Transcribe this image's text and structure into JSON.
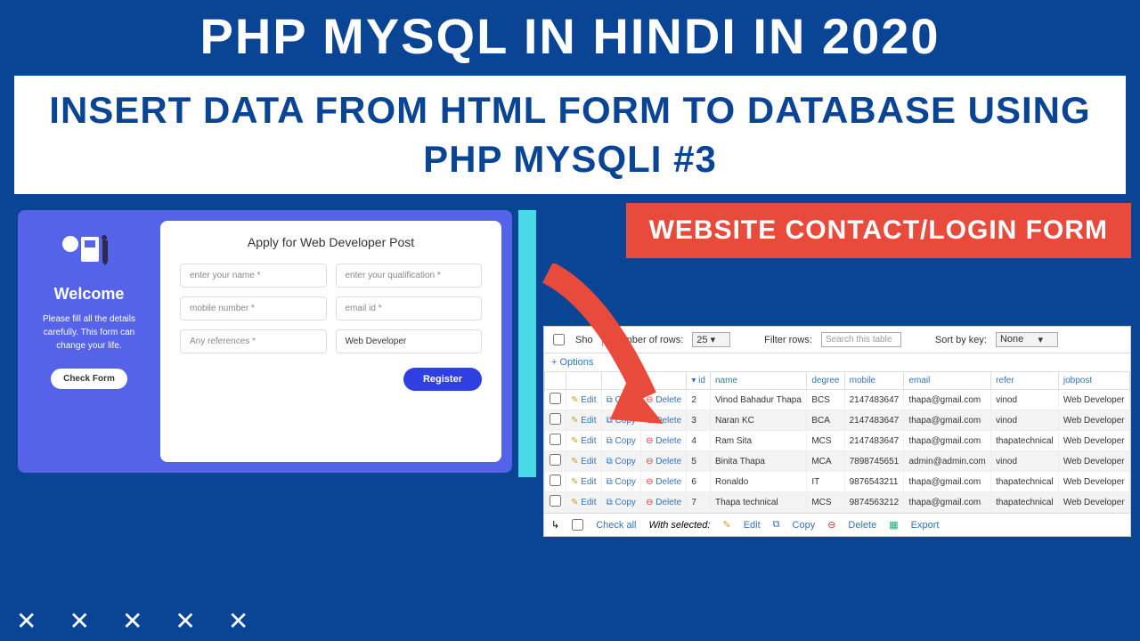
{
  "header": {
    "title": "PHP MYSQL IN HINDI IN 2020",
    "subtitle": "INSERT DATA FROM HTML FORM TO DATABASE USING PHP MYSQLI   #3"
  },
  "callout": "WEBSITE CONTACT/LOGIN FORM",
  "form": {
    "welcome": "Welcome",
    "intro": "Please fill all the details carefully. This form can change your life.",
    "check_btn": "Check Form",
    "title": "Apply for Web Developer Post",
    "fields": {
      "name": "enter your name *",
      "qualification": "enter your qualification *",
      "mobile": "mobile number *",
      "email": "email id *",
      "refs": "Any references *",
      "role": "Web Developer"
    },
    "register_btn": "Register"
  },
  "db": {
    "show_label": "Sho",
    "rows_label": "Number of rows:",
    "rows_value": "25",
    "filter_label": "Filter rows:",
    "filter_placeholder": "Search this table",
    "sort_label": "Sort by key:",
    "sort_value": "None",
    "options": "+ Options",
    "columns": [
      "",
      "",
      "",
      "",
      "id",
      "name",
      "degree",
      "mobile",
      "email",
      "refer",
      "jobpost"
    ],
    "edit_label": "Edit",
    "copy_label": "Copy",
    "delete_label": "Delete",
    "rows": [
      {
        "id": "2",
        "name": "Vinod Bahadur Thapa",
        "degree": "BCS",
        "mobile": "2147483647",
        "email": "thapa@gmail.com",
        "refer": "vinod",
        "jobpost": "Web Developer"
      },
      {
        "id": "3",
        "name": "Naran KC",
        "degree": "BCA",
        "mobile": "2147483647",
        "email": "thapa@gmail.com",
        "refer": "vinod",
        "jobpost": "Web Developer"
      },
      {
        "id": "4",
        "name": "Ram Sita",
        "degree": "MCS",
        "mobile": "2147483647",
        "email": "thapa@gmail.com",
        "refer": "thapatechnical",
        "jobpost": "Web Developer"
      },
      {
        "id": "5",
        "name": "Binita Thapa",
        "degree": "MCA",
        "mobile": "7898745651",
        "email": "admin@admin.com",
        "refer": "vinod",
        "jobpost": "Web Developer"
      },
      {
        "id": "6",
        "name": "Ronaldo",
        "degree": "IT",
        "mobile": "9876543211",
        "email": "thapa@gmail.com",
        "refer": "thapatechnical",
        "jobpost": "Web Developer"
      },
      {
        "id": "7",
        "name": "Thapa technical",
        "degree": "MCS",
        "mobile": "9874563212",
        "email": "thapa@gmail.com",
        "refer": "thapatechnical",
        "jobpost": "Web Developer"
      }
    ],
    "footer": {
      "checkall": "Check all",
      "withsel": "With selected:",
      "edit": "Edit",
      "copy": "Copy",
      "delete": "Delete",
      "export": "Export"
    }
  }
}
